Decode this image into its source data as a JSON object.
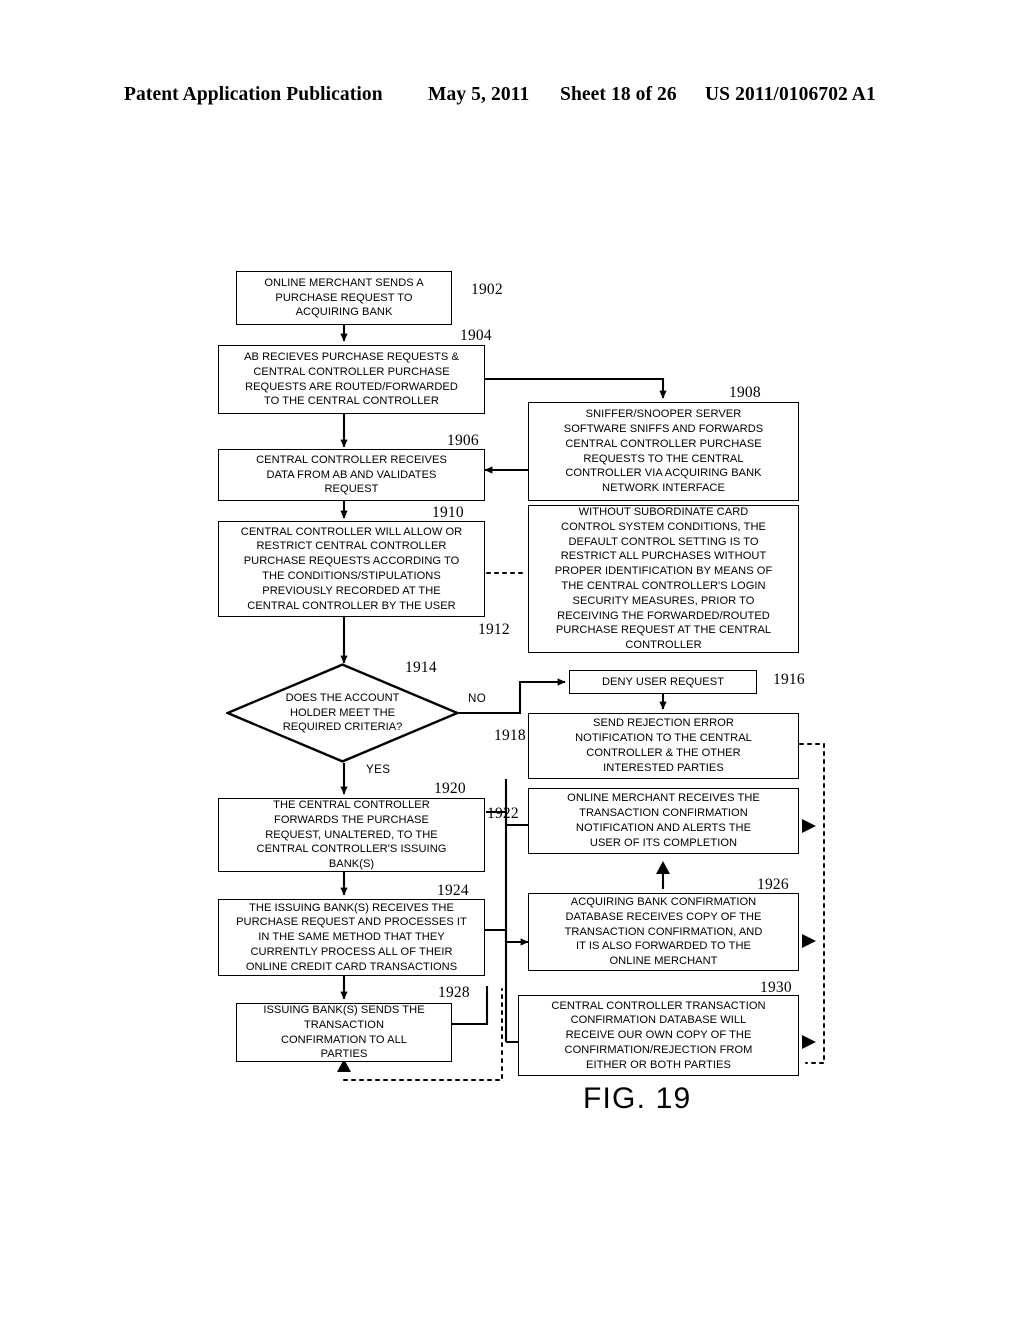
{
  "header": {
    "publication": "Patent Application Publication",
    "date": "May 5, 2011",
    "sheet": "Sheet 18 of 26",
    "patent_number": "US 2011/0106702 A1"
  },
  "figure": {
    "caption": "FIG. 19"
  },
  "branches": {
    "no": "NO",
    "yes": "YES"
  },
  "nodes": [
    {
      "id": "1902",
      "ref": "1902",
      "text": "ONLINE MERCHANT SENDS A\nPURCHASE REQUEST TO\nACQUIRING BANK"
    },
    {
      "id": "1904",
      "ref": "1904",
      "text": "AB RECIEVES PURCHASE REQUESTS &\nCENTRAL CONTROLLER PURCHASE\nREQUESTS ARE ROUTED/FORWARDED\nTO THE CENTRAL CONTROLLER"
    },
    {
      "id": "1906",
      "ref": "1906",
      "text": "CENTRAL CONTROLLER RECEIVES\nDATA FROM AB AND VALIDATES\nREQUEST"
    },
    {
      "id": "1908",
      "ref": "1908",
      "text": "SNIFFER/SNOOPER SERVER\nSOFTWARE SNIFFS AND FORWARDS\nCENTRAL CONTROLLER PURCHASE\nREQUESTS TO THE CENTRAL\nCONTROLLER VIA ACQUIRING BANK\nNETWORK INTERFACE"
    },
    {
      "id": "1910",
      "ref": "1910",
      "text": "CENTRAL CONTROLLER WILL ALLOW OR\nRESTRICT CENTRAL CONTROLLER\nPURCHASE REQUESTS ACCORDING TO\nTHE CONDITIONS/STIPULATIONS\nPREVIOUSLY RECORDED AT THE\nCENTRAL CONTROLLER BY THE USER"
    },
    {
      "id": "1912",
      "ref": "1912",
      "text": "WITHOUT SUBORDINATE CARD\nCONTROL SYSTEM CONDITIONS, THE\nDEFAULT CONTROL SETTING IS TO\nRESTRICT ALL PURCHASES WITHOUT\nPROPER IDENTIFICATION BY MEANS OF\nTHE CENTRAL CONTROLLER'S LOGIN\nSECURITY MEASURES, PRIOR TO\nRECEIVING THE FORWARDED/ROUTED\nPURCHASE REQUEST AT THE CENTRAL\nCONTROLLER"
    },
    {
      "id": "1914",
      "ref": "1914",
      "text": "DOES THE ACCOUNT\nHOLDER MEET THE\nREQUIRED CRITERIA?"
    },
    {
      "id": "1916",
      "ref": "1916",
      "text": "DENY USER REQUEST"
    },
    {
      "id": "1918",
      "ref": "1918",
      "text": "SEND REJECTION ERROR\nNOTIFICATION TO THE CENTRAL\nCONTROLLER & THE OTHER\nINTERESTED PARTIES"
    },
    {
      "id": "1920",
      "ref": "1920",
      "text": "THE CENTRAL CONTROLLER\nFORWARDS THE PURCHASE\nREQUEST, UNALTERED, TO THE\nCENTRAL CONTROLLER'S ISSUING\nBANK(S)"
    },
    {
      "id": "1922",
      "ref": "1922",
      "text": "ONLINE MERCHANT RECEIVES THE\nTRANSACTION CONFIRMATION\nNOTIFICATION AND ALERTS THE\nUSER OF ITS COMPLETION"
    },
    {
      "id": "1924",
      "ref": "1924",
      "text": "THE ISSUING BANK(S) RECEIVES THE\nPURCHASE REQUEST AND PROCESSES IT\nIN THE SAME METHOD THAT THEY\nCURRENTLY PROCESS ALL OF THEIR\nONLINE CREDIT CARD TRANSACTIONS"
    },
    {
      "id": "1926",
      "ref": "1926",
      "text": "ACQUIRING BANK CONFIRMATION\nDATABASE RECEIVES COPY OF THE\nTRANSACTION CONFIRMATION, AND\nIT IS ALSO FORWARDED TO THE\nONLINE MERCHANT"
    },
    {
      "id": "1928",
      "ref": "1928",
      "text": "ISSUING BANK(S) SENDS THE\nTRANSACTION\nCONFIRMATION TO ALL\nPARTIES"
    },
    {
      "id": "1930",
      "ref": "1930",
      "text": "CENTRAL CONTROLLER TRANSACTION\nCONFIRMATION DATABASE WILL\nRECEIVE OUR OWN COPY OF THE\nCONFIRMATION/REJECTION FROM\nEITHER OR BOTH PARTIES"
    }
  ]
}
